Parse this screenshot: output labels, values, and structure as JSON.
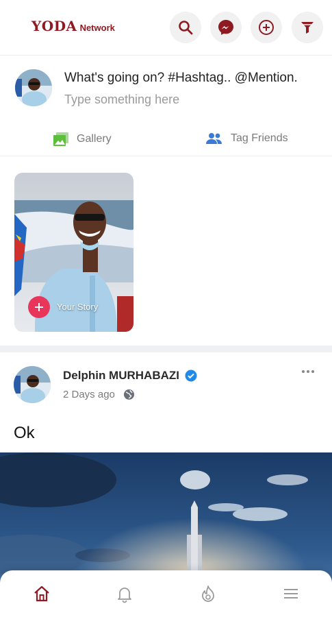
{
  "header": {
    "logo_main": "YODA",
    "logo_sub": "Network"
  },
  "composer": {
    "prompt": "What's going on? #Hashtag.. @Mention.",
    "placeholder": "Type something here",
    "gallery_label": "Gallery",
    "tag_friends_label": "Tag Friends"
  },
  "stories": {
    "your_story_label": "Your Story"
  },
  "post": {
    "author": "Delphin MURHABAZI",
    "time": "2 Days ago",
    "text": "Ok"
  },
  "colors": {
    "brand": "#8e1b22",
    "verified": "#1f8ae8",
    "gallery_icon": "#5bbf3a",
    "tag_icon": "#3b7bd6",
    "story_add": "#e8365a"
  }
}
